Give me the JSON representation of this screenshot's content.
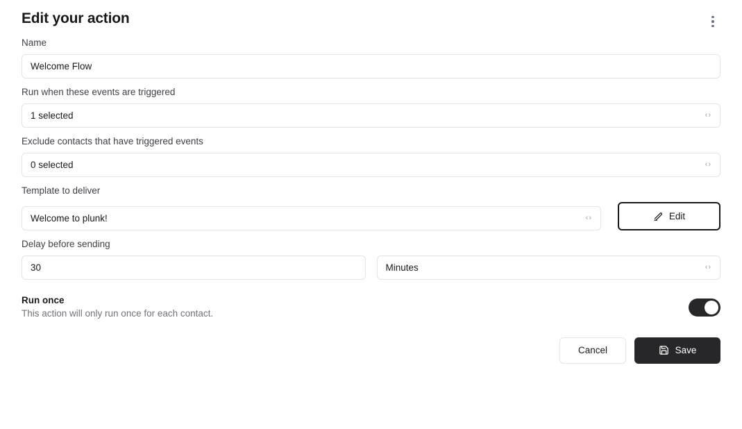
{
  "header": {
    "title": "Edit your action",
    "menu_icon": "kebab-menu-icon"
  },
  "form": {
    "name": {
      "label": "Name",
      "value": "Welcome Flow",
      "placeholder": "Name"
    },
    "trigger_events": {
      "label": "Run when these events are triggered",
      "value": "1 selected",
      "indicator_icon": "left-right-chevron-icon"
    },
    "exclude_events": {
      "label": "Exclude contacts that have triggered events",
      "value": "0 selected",
      "indicator_icon": "left-right-chevron-icon"
    },
    "template": {
      "label": "Template to deliver",
      "value": "Welcome to plunk!",
      "indicator_icon": "left-right-chevron-icon",
      "edit_button": {
        "label": "Edit",
        "icon": "pencil-icon"
      }
    },
    "delay": {
      "label": "Delay before sending",
      "amount": "30",
      "amount_placeholder": "30",
      "unit": "Minutes",
      "indicator_icon": "left-right-chevron-icon"
    },
    "run_once": {
      "title": "Run once",
      "description": "This action will only run once for each contact.",
      "enabled": true
    }
  },
  "footer": {
    "cancel_label": "Cancel",
    "save_label": "Save",
    "save_icon": "floppy-disk-icon"
  },
  "colors": {
    "accent": "#27272a",
    "text": "#18181b",
    "muted": "#71717a",
    "border": "#e4e4e7",
    "background": "#ffffff"
  }
}
